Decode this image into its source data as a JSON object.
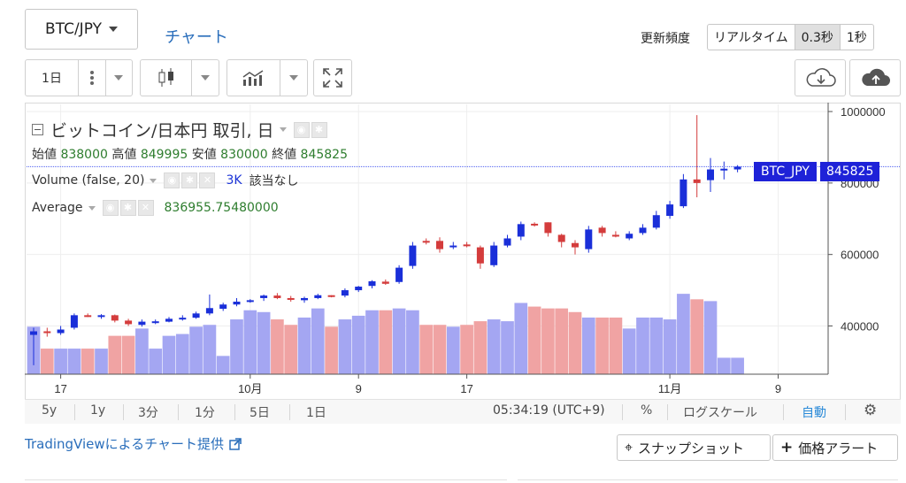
{
  "header": {
    "pair_select": "BTC/JPY",
    "chart_tab": "チャート",
    "freq_label": "更新頻度",
    "freq_options": [
      "リアルタイム",
      "0.3秒",
      "1秒"
    ],
    "freq_active": "0.3秒"
  },
  "toolbar": {
    "interval": "1日",
    "icons": [
      "more-vert-icon",
      "candlestick-icon",
      "indicators-icon",
      "fullscreen-icon",
      "cloud-download-icon",
      "cloud-upload-icon"
    ]
  },
  "legend": {
    "title": "ビットコイン/日本円 取引, 日",
    "ohlc": [
      {
        "label": "始値",
        "value": "838000"
      },
      {
        "label": "高値",
        "value": "849995"
      },
      {
        "label": "安値",
        "value": "830000"
      },
      {
        "label": "終値",
        "value": "845825"
      }
    ],
    "volume_label": "Volume (false, 20)",
    "volume_value": "3K",
    "volume_note": "該当なし",
    "average_label": "Average",
    "average_value": "836955.75480000"
  },
  "price_tag": {
    "symbol": "BTC_JPY",
    "value": "845825"
  },
  "y_ticks": [
    "1000000",
    "800000",
    "600000",
    "400000"
  ],
  "x_ticks": [
    "17",
    "10月",
    "9",
    "17",
    "11月",
    "9"
  ],
  "bottom_bar": {
    "ranges": [
      "5y",
      "1y",
      "3分",
      "1分",
      "5日",
      "1日"
    ],
    "time": "05:34:19 (UTC+9)",
    "percent": "%",
    "log_scale": "ログスケール",
    "auto": "自動"
  },
  "footer": {
    "credit": "TradingViewによるチャート提供",
    "snapshot": "スナップショット",
    "price_alert": "価格アラート"
  },
  "colors": {
    "up": "#1a2fd9",
    "down": "#d43c3c",
    "vol_up": "#a4a6f2",
    "vol_down": "#f0a3a3",
    "accent": "#2a6ebb"
  },
  "chart_data": {
    "type": "candlestick",
    "ylim": [
      265000,
      1020000
    ],
    "candles": [
      {
        "o": 375000,
        "h": 395000,
        "l": 290000,
        "c": 385000,
        "v": 2.6
      },
      {
        "o": 385000,
        "h": 395000,
        "l": 370000,
        "c": 380000,
        "v": 1.4
      },
      {
        "o": 380000,
        "h": 400000,
        "l": 375000,
        "c": 390000,
        "v": 1.4
      },
      {
        "o": 395000,
        "h": 435000,
        "l": 390000,
        "c": 430000,
        "v": 1.4
      },
      {
        "o": 430000,
        "h": 435000,
        "l": 425000,
        "c": 428000,
        "v": 1.4
      },
      {
        "o": 428000,
        "h": 433000,
        "l": 420000,
        "c": 430000,
        "v": 1.4
      },
      {
        "o": 430000,
        "h": 432000,
        "l": 410000,
        "c": 415000,
        "v": 2.1
      },
      {
        "o": 415000,
        "h": 420000,
        "l": 400000,
        "c": 405000,
        "v": 2.1
      },
      {
        "o": 403000,
        "h": 418000,
        "l": 398000,
        "c": 412000,
        "v": 2.5
      },
      {
        "o": 410000,
        "h": 418000,
        "l": 405000,
        "c": 413000,
        "v": 1.4
      },
      {
        "o": 412000,
        "h": 425000,
        "l": 410000,
        "c": 420000,
        "v": 2.1
      },
      {
        "o": 420000,
        "h": 430000,
        "l": 415000,
        "c": 423000,
        "v": 2.2
      },
      {
        "o": 423000,
        "h": 440000,
        "l": 420000,
        "c": 435000,
        "v": 2.6
      },
      {
        "o": 435000,
        "h": 488000,
        "l": 430000,
        "c": 450000,
        "v": 2.7
      },
      {
        "o": 448000,
        "h": 465000,
        "l": 442000,
        "c": 460000,
        "v": 1.0
      },
      {
        "o": 460000,
        "h": 478000,
        "l": 455000,
        "c": 468000,
        "v": 3.0
      },
      {
        "o": 470000,
        "h": 475000,
        "l": 465000,
        "c": 472000,
        "v": 3.5
      },
      {
        "o": 478000,
        "h": 488000,
        "l": 470000,
        "c": 485000,
        "v": 3.4
      },
      {
        "o": 485000,
        "h": 492000,
        "l": 475000,
        "c": 478000,
        "v": 3.0
      },
      {
        "o": 478000,
        "h": 484000,
        "l": 468000,
        "c": 475000,
        "v": 2.7
      },
      {
        "o": 472000,
        "h": 482000,
        "l": 465000,
        "c": 478000,
        "v": 3.1
      },
      {
        "o": 478000,
        "h": 490000,
        "l": 475000,
        "c": 486000,
        "v": 3.6
      },
      {
        "o": 486000,
        "h": 486000,
        "l": 480000,
        "c": 482000,
        "v": 2.6
      },
      {
        "o": 485000,
        "h": 505000,
        "l": 480000,
        "c": 500000,
        "v": 3.0
      },
      {
        "o": 500000,
        "h": 512000,
        "l": 495000,
        "c": 510000,
        "v": 3.2
      },
      {
        "o": 512000,
        "h": 528000,
        "l": 505000,
        "c": 525000,
        "v": 3.5
      },
      {
        "o": 524000,
        "h": 530000,
        "l": 515000,
        "c": 518000,
        "v": 3.5
      },
      {
        "o": 523000,
        "h": 570000,
        "l": 518000,
        "c": 563000,
        "v": 3.6
      },
      {
        "o": 568000,
        "h": 635000,
        "l": 560000,
        "c": 625000,
        "v": 3.5
      },
      {
        "o": 638000,
        "h": 645000,
        "l": 628000,
        "c": 633000,
        "v": 2.7
      },
      {
        "o": 638000,
        "h": 648000,
        "l": 605000,
        "c": 615000,
        "v": 2.7
      },
      {
        "o": 625000,
        "h": 635000,
        "l": 615000,
        "c": 625000,
        "v": 2.6
      },
      {
        "o": 628000,
        "h": 635000,
        "l": 620000,
        "c": 625000,
        "v": 2.7
      },
      {
        "o": 620000,
        "h": 625000,
        "l": 560000,
        "c": 575000,
        "v": 2.9
      },
      {
        "o": 570000,
        "h": 635000,
        "l": 565000,
        "c": 625000,
        "v": 3.0
      },
      {
        "o": 625000,
        "h": 655000,
        "l": 620000,
        "c": 645000,
        "v": 2.9
      },
      {
        "o": 650000,
        "h": 692000,
        "l": 640000,
        "c": 685000,
        "v": 3.9
      },
      {
        "o": 686000,
        "h": 690000,
        "l": 678000,
        "c": 685000,
        "v": 3.7
      },
      {
        "o": 690000,
        "h": 690000,
        "l": 650000,
        "c": 660000,
        "v": 3.6
      },
      {
        "o": 655000,
        "h": 658000,
        "l": 620000,
        "c": 635000,
        "v": 3.6
      },
      {
        "o": 632000,
        "h": 640000,
        "l": 600000,
        "c": 620000,
        "v": 3.4
      },
      {
        "o": 615000,
        "h": 680000,
        "l": 605000,
        "c": 670000,
        "v": 3.1
      },
      {
        "o": 675000,
        "h": 680000,
        "l": 650000,
        "c": 660000,
        "v": 3.1
      },
      {
        "o": 655000,
        "h": 665000,
        "l": 648000,
        "c": 652000,
        "v": 3.1
      },
      {
        "o": 645000,
        "h": 665000,
        "l": 640000,
        "c": 658000,
        "v": 2.5
      },
      {
        "o": 660000,
        "h": 685000,
        "l": 655000,
        "c": 675000,
        "v": 3.1
      },
      {
        "o": 675000,
        "h": 722000,
        "l": 670000,
        "c": 710000,
        "v": 3.1
      },
      {
        "o": 708000,
        "h": 750000,
        "l": 700000,
        "c": 740000,
        "v": 3.0
      },
      {
        "o": 735000,
        "h": 825000,
        "l": 730000,
        "c": 810000,
        "v": 4.4
      },
      {
        "o": 810000,
        "h": 990000,
        "l": 760000,
        "c": 800000,
        "v": 4.1
      },
      {
        "o": 808000,
        "h": 870000,
        "l": 775000,
        "c": 838000,
        "v": 4.0
      },
      {
        "o": 838000,
        "h": 860000,
        "l": 810000,
        "c": 840000,
        "v": 0.9
      },
      {
        "o": 838000,
        "h": 850000,
        "l": 830000,
        "c": 845825,
        "v": 0.9
      }
    ]
  }
}
